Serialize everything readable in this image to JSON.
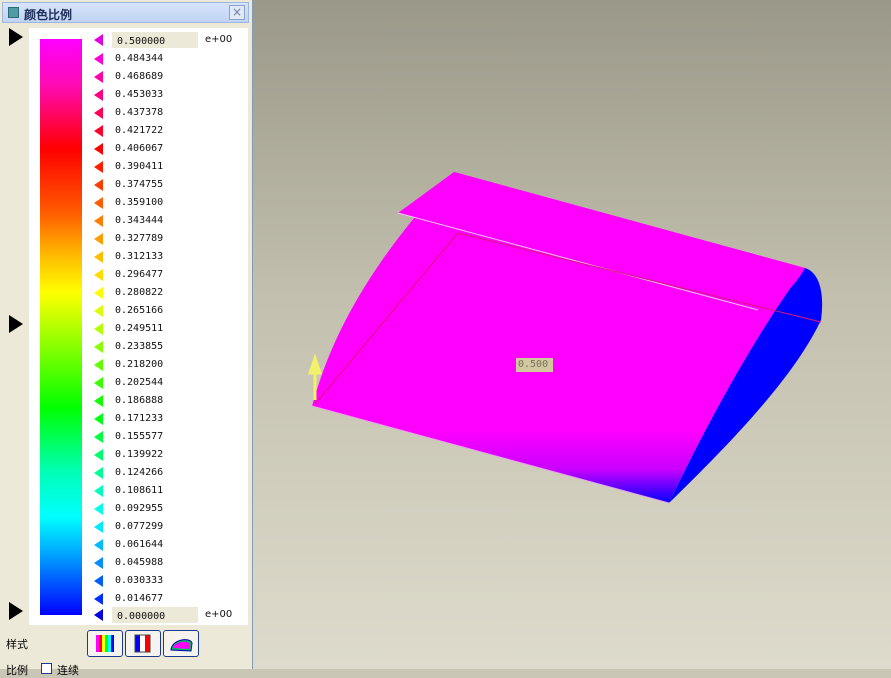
{
  "panel": {
    "title": "颜色比例",
    "close_label": "×",
    "max_value": "0.500000",
    "max_exponent": "e+00",
    "min_value": "0.000000",
    "min_exponent": "e+00",
    "values": [
      "0.484344",
      "0.468689",
      "0.453033",
      "0.437378",
      "0.421722",
      "0.406067",
      "0.390411",
      "0.374755",
      "0.359100",
      "0.343444",
      "0.327789",
      "0.312133",
      "0.296477",
      "0.280822",
      "0.265166",
      "0.249511",
      "0.233855",
      "0.218200",
      "0.202544",
      "0.186888",
      "0.171233",
      "0.155577",
      "0.139922",
      "0.124266",
      "0.108611",
      "0.092955",
      "0.077299",
      "0.061644",
      "0.045988",
      "0.030333",
      "0.014677"
    ],
    "style_label": "样式",
    "style_buttons": [
      "spectrum-style-icon",
      "bar-style-icon",
      "surface-style-icon"
    ],
    "scale_label": "比例",
    "continuous_label": "连续",
    "colors": [
      "#ff00ff",
      "#ff0000",
      "#ffff00",
      "#00ff00",
      "#00ffff",
      "#0000ff"
    ]
  },
  "viewport": {
    "value_label": "0.500",
    "surface_color": "#ff00ff",
    "end_face_color": "#0000ff"
  }
}
